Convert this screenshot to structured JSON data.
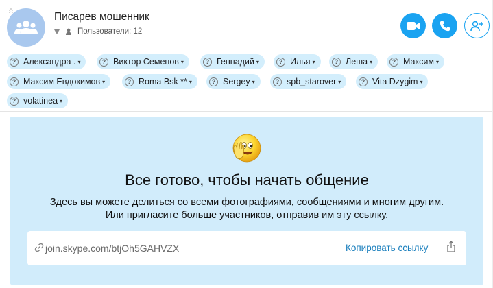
{
  "header": {
    "title": "Писарев мошенник",
    "members_count": "Пользователи: 12"
  },
  "members": [
    {
      "name": "Александра ."
    },
    {
      "name": "Виктор Семенов"
    },
    {
      "name": "Геннадий"
    },
    {
      "name": "Илья"
    },
    {
      "name": "Леша"
    },
    {
      "name": "Максим"
    },
    {
      "name": "Максим Евдокимов"
    },
    {
      "name": "Roma Bsk **"
    },
    {
      "name": "Sergey"
    },
    {
      "name": "spb_starover"
    },
    {
      "name": "Vita Dzygim"
    },
    {
      "name": "volatinea"
    }
  ],
  "welcome": {
    "headline": "Все готово, чтобы начать общение",
    "line1": "Здесь вы можете делиться со всеми фотографиями, сообщениями и многим другим.",
    "line2": "Или пригласите больше участников, отправив им эту ссылку.",
    "link": "join.skype.com/btjOh5GAHVZX",
    "copy_label": "Копировать ссылку"
  },
  "icons": {
    "avatar": "group-avatar-icon",
    "video": "video-call-icon",
    "call": "phone-icon",
    "add": "add-person-icon"
  },
  "colors": {
    "accent": "#1aa3f1",
    "chip_bg": "#d3eefc",
    "panel_bg": "#d1ecfb",
    "link": "#1a7fbd"
  }
}
